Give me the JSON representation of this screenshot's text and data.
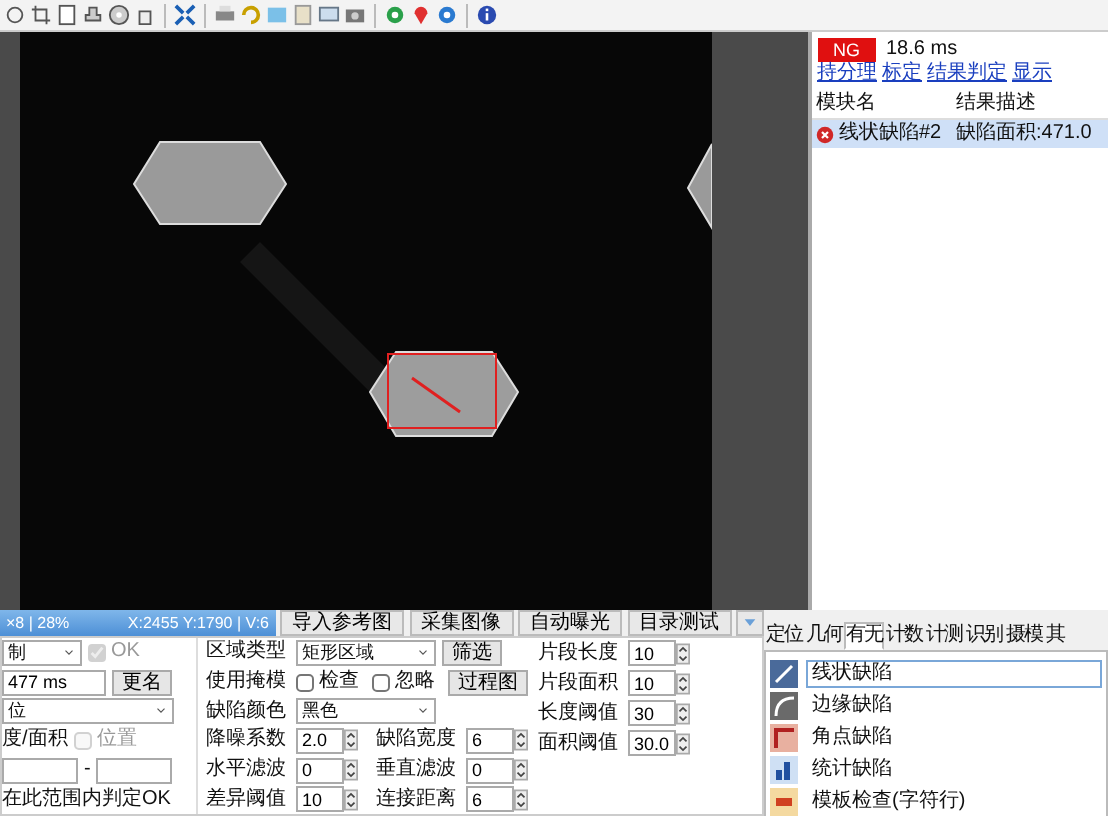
{
  "result_panel": {
    "status": "NG",
    "time": "18.6 ms",
    "links": [
      "持分理",
      "标定",
      "结果判定",
      "显示"
    ],
    "columns": [
      "模块名",
      "结果描述"
    ],
    "rows": [
      {
        "module": "线状缺陷#2",
        "result": "缺陷面积:471.0",
        "error": true,
        "selected": true
      }
    ]
  },
  "status_bar": {
    "zoom": "×8 | 28%",
    "cursor": "X:2455 Y:1790 | V:6"
  },
  "action_buttons": [
    "导入参考图",
    "采集图像",
    "自动曝光",
    "目录测试"
  ],
  "basic": {
    "limit_select": "制",
    "ok_check": {
      "label": "OK",
      "checked": true,
      "disabled": true
    },
    "time_value": "477 ms",
    "rename_button": "更名",
    "mode_select": "位",
    "range_label": "度/面积",
    "position_check": {
      "label": "位置",
      "checked": false,
      "disabled": true
    },
    "range_separator": "-",
    "ok_note": "在此范围内判定OK"
  },
  "region": {
    "type_label": "区域类型",
    "type_value": "矩形区域",
    "filter_button": "筛选",
    "mask_label": "使用掩模",
    "mask_options": [
      {
        "label": "检查",
        "checked": false
      },
      {
        "label": "忽略",
        "checked": false
      }
    ],
    "process_button": "过程图",
    "color_label": "缺陷颜色",
    "color_value": "黑色"
  },
  "params": [
    {
      "label": "降噪系数",
      "value": "2.0"
    },
    {
      "label": "缺陷宽度",
      "value": "6"
    },
    {
      "label": "水平滤波",
      "value": "0"
    },
    {
      "label": "垂直滤波",
      "value": "0"
    },
    {
      "label": "差异阈值",
      "value": "10"
    },
    {
      "label": "连接距离",
      "value": "6"
    }
  ],
  "segment_params": [
    {
      "label": "片段长度",
      "value": "10"
    },
    {
      "label": "片段面积",
      "value": "10"
    },
    {
      "label": "长度阈值",
      "value": "30"
    },
    {
      "label": "面积阈值",
      "value": "30.0"
    }
  ],
  "tool_tabs": [
    {
      "label": "定位",
      "selected": false
    },
    {
      "label": "几何",
      "selected": false
    },
    {
      "label": "有无",
      "selected": true
    },
    {
      "label": "计数",
      "selected": false
    },
    {
      "label": "计测",
      "selected": false
    },
    {
      "label": "识别",
      "selected": false
    },
    {
      "label": "摄模",
      "selected": false
    },
    {
      "label": "其",
      "selected": false
    }
  ],
  "tools": [
    {
      "label": "线状缺陷",
      "selected": true
    },
    {
      "label": "边缘缺陷",
      "selected": false
    },
    {
      "label": "角点缺陷",
      "selected": false
    },
    {
      "label": "统计缺陷",
      "selected": false
    },
    {
      "label": "模板检查(字符行)",
      "selected": false
    }
  ]
}
